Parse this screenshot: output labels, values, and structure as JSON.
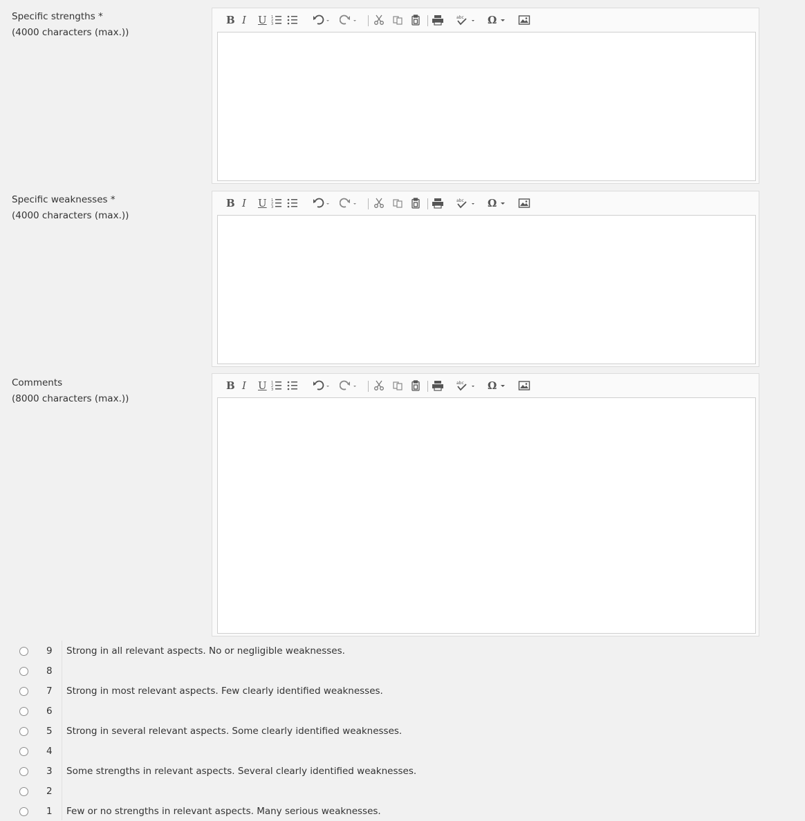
{
  "toolbar": {
    "bold": "B",
    "italic": "I",
    "underline": "U",
    "numbered_list": "numbered-list-icon",
    "bulleted_list": "bulleted-list-icon",
    "undo": "undo-icon",
    "redo": "redo-icon",
    "cut": "cut-icon",
    "copy": "copy-icon",
    "paste": "paste-icon",
    "print": "print-icon",
    "spellcheck": "spellcheck-icon",
    "special_char": "Ω",
    "image": "image-icon"
  },
  "fields": [
    {
      "label": "Specific strengths *",
      "limit": "(4000 characters (max.))",
      "value": ""
    },
    {
      "label": "Specific weaknesses *",
      "limit": "(4000 characters (max.))",
      "value": ""
    },
    {
      "label": "Comments",
      "limit": "(8000 characters (max.))",
      "value": ""
    }
  ],
  "scale": [
    {
      "score": "9",
      "text": "Strong in all relevant aspects. No or negligible weaknesses."
    },
    {
      "score": "8",
      "text": ""
    },
    {
      "score": "7",
      "text": "Strong in most relevant aspects. Few clearly identified weaknesses."
    },
    {
      "score": "6",
      "text": ""
    },
    {
      "score": "5",
      "text": "Strong in several relevant aspects. Some clearly identified weaknesses."
    },
    {
      "score": "4",
      "text": ""
    },
    {
      "score": "3",
      "text": "Some strengths in relevant aspects. Several clearly identified weaknesses."
    },
    {
      "score": "2",
      "text": ""
    },
    {
      "score": "1",
      "text": "Few or no strengths in relevant aspects. Many serious weaknesses."
    }
  ]
}
